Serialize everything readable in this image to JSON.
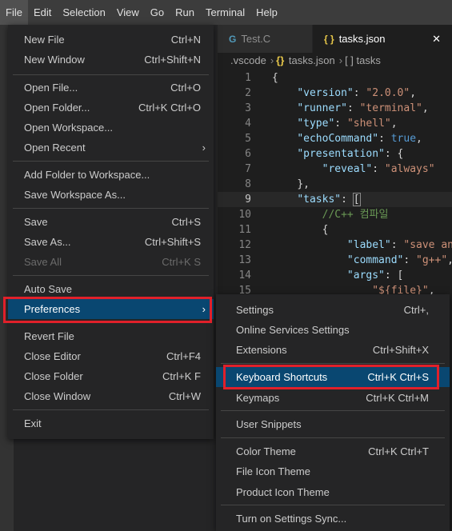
{
  "menubar": {
    "items": [
      "File",
      "Edit",
      "Selection",
      "View",
      "Go",
      "Run",
      "Terminal",
      "Help"
    ]
  },
  "tabs": {
    "inactive": {
      "label": "Test.C",
      "icon": "c-file-icon",
      "glyph": "G"
    },
    "active": {
      "label": "tasks.json",
      "icon": "json-file-icon",
      "glyph": "{ }",
      "close": "✕"
    }
  },
  "breadcrumb": {
    "folder": ".vscode",
    "file": "tasks.json",
    "file_glyph": "{}",
    "symbol": "[ ] tasks",
    "separator": "›"
  },
  "editor": {
    "lines": [
      {
        "n": "1",
        "html": "<span class='p'>{</span>"
      },
      {
        "n": "2",
        "html": "    <span class='k'>\"version\"</span><span class='p'>: </span><span class='s'>\"2.0.0\"</span><span class='p'>,</span>"
      },
      {
        "n": "3",
        "html": "    <span class='k'>\"runner\"</span><span class='p'>: </span><span class='s'>\"terminal\"</span><span class='p'>,</span>"
      },
      {
        "n": "4",
        "html": "    <span class='k'>\"type\"</span><span class='p'>: </span><span class='s'>\"shell\"</span><span class='p'>,</span>"
      },
      {
        "n": "5",
        "html": "    <span class='k'>\"echoCommand\"</span><span class='p'>: </span><span class='b'>true</span><span class='p'>,</span>"
      },
      {
        "n": "6",
        "html": "    <span class='k'>\"presentation\"</span><span class='p'>: {</span>"
      },
      {
        "n": "7",
        "html": "        <span class='k'>\"reveal\"</span><span class='p'>: </span><span class='s'>\"always\"</span>"
      },
      {
        "n": "8",
        "html": "    <span class='p'>},</span>"
      },
      {
        "n": "9",
        "html": "    <span class='k'>\"tasks\"</span><span class='p'>: </span><span class='p bracket-box'>[</span>"
      },
      {
        "n": "10",
        "html": "        <span class='c'>//C++ 컴파일</span>"
      },
      {
        "n": "11",
        "html": "        <span class='p'>{</span>"
      },
      {
        "n": "12",
        "html": "            <span class='k'>\"label\"</span><span class='p'>: </span><span class='s'>\"save and</span>"
      },
      {
        "n": "13",
        "html": "            <span class='k'>\"command\"</span><span class='p'>: </span><span class='s'>\"g++\"</span><span class='p'>,</span>"
      },
      {
        "n": "14",
        "html": "            <span class='k'>\"args\"</span><span class='p'>: [</span>"
      },
      {
        "n": "15",
        "html": "                <span class='s'>\"${file}\"</span><span class='p'>,</span>"
      }
    ]
  },
  "file_menu": {
    "items": [
      {
        "label": "New File",
        "kb": "Ctrl+N"
      },
      {
        "label": "New Window",
        "kb": "Ctrl+Shift+N"
      },
      {
        "label": "Open File...",
        "kb": "Ctrl+O"
      },
      {
        "label": "Open Folder...",
        "kb": "Ctrl+K Ctrl+O"
      },
      {
        "label": "Open Workspace...",
        "kb": ""
      },
      {
        "label": "Open Recent",
        "kb": "",
        "submenu": true
      },
      {
        "label": "Add Folder to Workspace...",
        "kb": ""
      },
      {
        "label": "Save Workspace As...",
        "kb": ""
      },
      {
        "label": "Save",
        "kb": "Ctrl+S"
      },
      {
        "label": "Save As...",
        "kb": "Ctrl+Shift+S"
      },
      {
        "label": "Save All",
        "kb": "Ctrl+K S",
        "disabled": true
      },
      {
        "label": "Auto Save",
        "kb": ""
      },
      {
        "label": "Preferences",
        "kb": "",
        "submenu": true,
        "highlighted": true
      },
      {
        "label": "Revert File",
        "kb": ""
      },
      {
        "label": "Close Editor",
        "kb": "Ctrl+F4"
      },
      {
        "label": "Close Folder",
        "kb": "Ctrl+K F"
      },
      {
        "label": "Close Window",
        "kb": "Ctrl+W"
      },
      {
        "label": "Exit",
        "kb": ""
      }
    ],
    "submenu_arrow": "›"
  },
  "pref_menu": {
    "items": [
      {
        "label": "Settings",
        "kb": "Ctrl+,"
      },
      {
        "label": "Online Services Settings",
        "kb": ""
      },
      {
        "label": "Extensions",
        "kb": "Ctrl+Shift+X"
      },
      {
        "label": "Keyboard Shortcuts",
        "kb": "Ctrl+K Ctrl+S",
        "highlighted": true
      },
      {
        "label": "Keymaps",
        "kb": "Ctrl+K Ctrl+M"
      },
      {
        "label": "User Snippets",
        "kb": ""
      },
      {
        "label": "Color Theme",
        "kb": "Ctrl+K Ctrl+T"
      },
      {
        "label": "File Icon Theme",
        "kb": ""
      },
      {
        "label": "Product Icon Theme",
        "kb": ""
      },
      {
        "label": "Turn on Settings Sync...",
        "kb": ""
      }
    ]
  },
  "colors": {
    "highlight": "#094771",
    "annotation_box": "#e0202a",
    "menu_bg": "#252526"
  }
}
